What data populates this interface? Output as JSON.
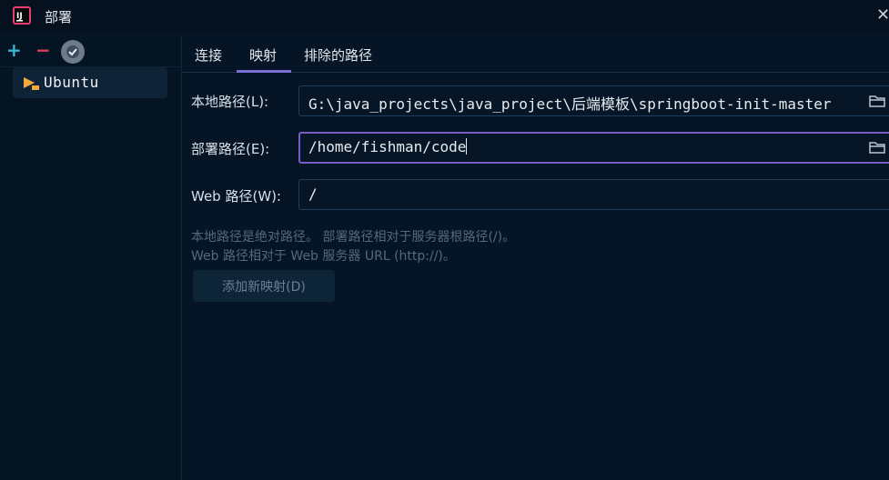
{
  "window": {
    "title": "部署",
    "close_glyph": "✕",
    "logo_icon": "app-logo-icon"
  },
  "left_toolbar": {
    "add_glyph": "+",
    "remove_glyph": "−",
    "check_icon": "check-badge-icon"
  },
  "servers": [
    {
      "label": "Ubuntu",
      "icon": "sftp-server-icon"
    }
  ],
  "tabs": [
    {
      "label": "连接",
      "active": false
    },
    {
      "label": "映射",
      "active": true
    },
    {
      "label": "排除的路径",
      "active": false
    }
  ],
  "form": {
    "local_path": {
      "label": "本地路径(L):",
      "value": "G:\\java_projects\\java_project\\后端模板\\springboot-init-master"
    },
    "deploy_path": {
      "label": "部署路径(E):",
      "value": "/home/fishman/code"
    },
    "web_path": {
      "label": "Web 路径(W):",
      "value": "/"
    }
  },
  "hints": {
    "line1": "本地路径是绝对路径。 部署路径相对于服务器根路径(/)。",
    "line2": "Web 路径相对于 Web 服务器 URL (http://)。"
  },
  "add_mapping_button": "添加新映射(D)",
  "colors": {
    "accent": "#7b6fd6",
    "focus_border": "#7b5cc4",
    "add": "#39b6d8",
    "remove": "#e0405e"
  }
}
